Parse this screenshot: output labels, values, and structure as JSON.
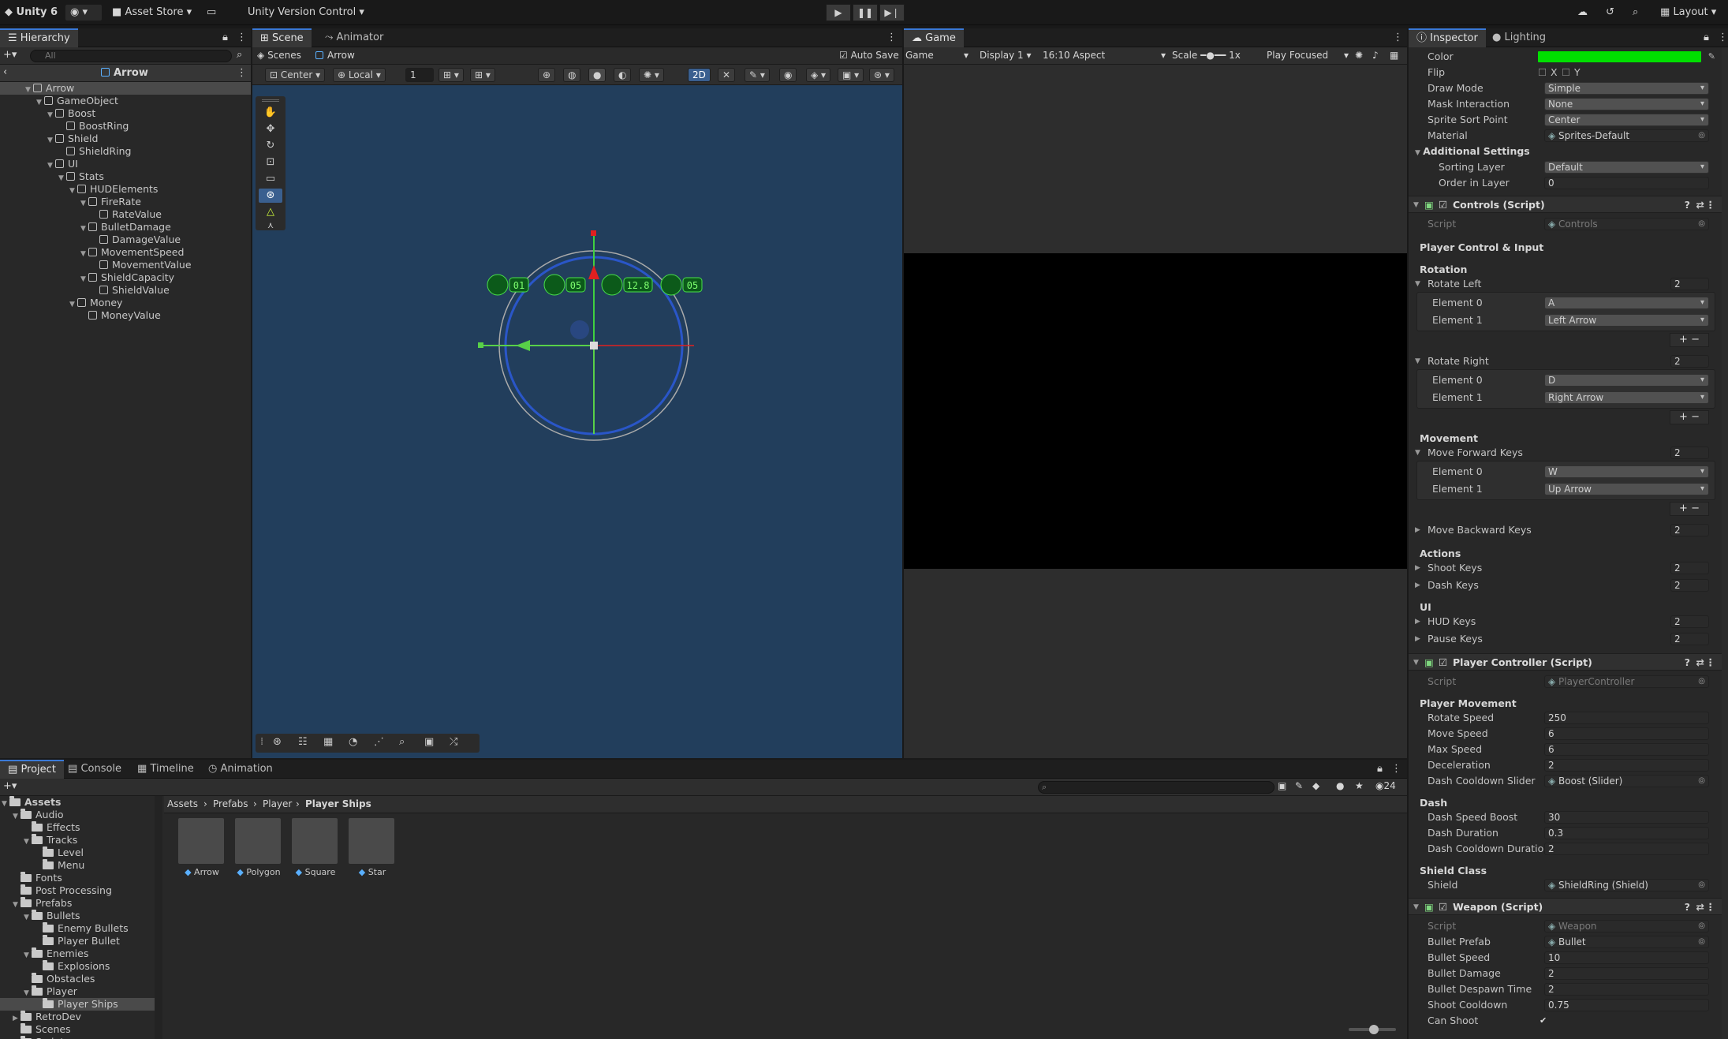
{
  "toolbar": {
    "app": "Unity 6",
    "account": "",
    "asset_store": "Asset Store",
    "version_control": "Unity Version Control",
    "layout": "Layout"
  },
  "hierarchy": {
    "tab": "Hierarchy",
    "search": "All",
    "scene_root": "Arrow",
    "items": [
      "Arrow",
      "GameObject",
      "Boost",
      "BoostRing",
      "Shield",
      "ShieldRing",
      "UI",
      "Stats",
      "HUDElements",
      "FireRate",
      "RateValue",
      "BulletDamage",
      "DamageValue",
      "MovementSpeed",
      "MovementValue",
      "ShieldCapacity",
      "ShieldValue",
      "Money",
      "MoneyValue"
    ]
  },
  "scene": {
    "tabs": [
      "Scene",
      "Animator"
    ],
    "breadcrumb_scenes": "Scenes",
    "breadcrumb_prefab": "Arrow",
    "auto_save": "Auto Save",
    "pivot": "Center",
    "space": "Local",
    "snap": "1",
    "mode_2d": "2D",
    "hud": [
      "01",
      "05",
      "12.8",
      "05"
    ]
  },
  "game": {
    "tab": "Game",
    "display_mode": "Game",
    "display": "Display 1",
    "aspect": "16:10 Aspect",
    "scale_label": "Scale",
    "scale_value": "1x",
    "play_mode": "Play Focused"
  },
  "inspector": {
    "tabs": [
      "Inspector",
      "Lighting"
    ],
    "sprite": [
      {
        "label": "Color",
        "type": "color",
        "color": "#00e000"
      },
      {
        "label": "Flip",
        "type": "flip",
        "x": "X",
        "y": "Y"
      },
      {
        "label": "Draw Mode",
        "value": "Simple",
        "type": "dd"
      },
      {
        "label": "Mask Interaction",
        "value": "None",
        "type": "dd"
      },
      {
        "label": "Sprite Sort Point",
        "value": "Center",
        "type": "dd"
      },
      {
        "label": "Material",
        "value": "Sprites-Default",
        "type": "obj"
      }
    ],
    "additional": "Additional Settings",
    "sorting_layer": {
      "label": "Sorting Layer",
      "value": "Default"
    },
    "order": {
      "label": "Order in Layer",
      "value": "0"
    },
    "controls": {
      "title": "Controls (Script)",
      "script_label": "Script",
      "script_value": "Controls",
      "section": "Player Control & Input",
      "rotation": "Rotation",
      "rotate_left": {
        "label": "Rotate Left",
        "count": "2",
        "elements": [
          [
            "Element 0",
            "A"
          ],
          [
            "Element 1",
            "Left Arrow"
          ]
        ]
      },
      "rotate_right": {
        "label": "Rotate Right",
        "count": "2",
        "elements": [
          [
            "Element 0",
            "D"
          ],
          [
            "Element 1",
            "Right Arrow"
          ]
        ]
      },
      "movement": "Movement",
      "move_forward": {
        "label": "Move Forward Keys",
        "count": "2",
        "elements": [
          [
            "Element 0",
            "W"
          ],
          [
            "Element 1",
            "Up Arrow"
          ]
        ]
      },
      "move_backward": {
        "label": "Move Backward Keys",
        "count": "2"
      },
      "actions": "Actions",
      "shoot": {
        "label": "Shoot Keys",
        "count": "2"
      },
      "dash": {
        "label": "Dash Keys",
        "count": "2"
      },
      "ui": "UI",
      "hud": {
        "label": "HUD Keys",
        "count": "2"
      },
      "pause": {
        "label": "Pause Keys",
        "count": "2"
      }
    },
    "player": {
      "title": "Player Controller (Script)",
      "script_label": "Script",
      "script_value": "PlayerController",
      "movement": "Player Movement",
      "fields": [
        [
          "Rotate Speed",
          "250"
        ],
        [
          "Move Speed",
          "6"
        ],
        [
          "Max Speed",
          "6"
        ],
        [
          "Deceleration",
          "2"
        ],
        [
          "Dash Cooldown Slider",
          "Boost (Slider)"
        ]
      ],
      "dash": "Dash",
      "dash_fields": [
        [
          "Dash Speed Boost",
          "30"
        ],
        [
          "Dash Duration",
          "0.3"
        ],
        [
          "Dash Cooldown Duration",
          "2"
        ]
      ],
      "shield_class": "Shield Class",
      "shield": {
        "label": "Shield",
        "value": "ShieldRing (Shield)"
      }
    },
    "weapon": {
      "title": "Weapon (Script)",
      "script_label": "Script",
      "script_value": "Weapon",
      "fields": [
        [
          "Bullet Prefab",
          "Bullet"
        ],
        [
          "Bullet Speed",
          "10"
        ],
        [
          "Bullet Damage",
          "2"
        ],
        [
          "Bullet Despawn Time",
          "2"
        ],
        [
          "Shoot Cooldown",
          "0.75"
        ]
      ],
      "can_shoot": "Can Shoot"
    }
  },
  "project": {
    "tabs": [
      "Project",
      "Console",
      "Timeline",
      "Animation"
    ],
    "count": "24",
    "tree": [
      "Assets",
      "Audio",
      "Effects",
      "Tracks",
      "Level",
      "Menu",
      "Fonts",
      "Post Processing",
      "Prefabs",
      "Bullets",
      "Enemy Bullets",
      "Player Bullet",
      "Enemies",
      "Explosions",
      "Obstacles",
      "Player",
      "Player Ships",
      "RetroDev",
      "Scenes",
      "Scripts"
    ],
    "breadcrumb": [
      "Assets",
      "Prefabs",
      "Player",
      "Player Ships"
    ],
    "assets": [
      "Arrow",
      "Polygon",
      "Square",
      "Star"
    ]
  }
}
